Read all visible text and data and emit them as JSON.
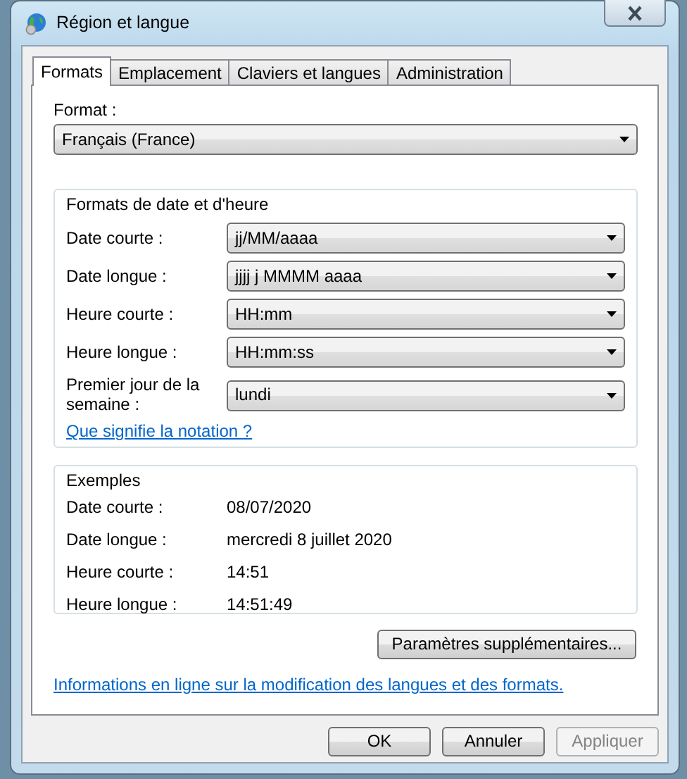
{
  "window": {
    "title": "Région et langue"
  },
  "tabs": [
    {
      "label": "Formats",
      "selected": true
    },
    {
      "label": "Emplacement",
      "selected": false
    },
    {
      "label": "Claviers et langues",
      "selected": false
    },
    {
      "label": "Administration",
      "selected": false
    }
  ],
  "format": {
    "label": "Format :",
    "value": "Français (France)"
  },
  "date_time_formats": {
    "title": "Formats de date et d'heure",
    "fields": [
      {
        "label": "Date courte :",
        "value": "jj/MM/aaaa"
      },
      {
        "label": "Date longue :",
        "value": "jjjj j MMMM aaaa"
      },
      {
        "label": "Heure courte :",
        "value": "HH:mm"
      },
      {
        "label": "Heure longue :",
        "value": "HH:mm:ss"
      },
      {
        "label": "Premier jour de la semaine :",
        "value": "lundi"
      }
    ],
    "link": "Que signifie la notation ?"
  },
  "examples": {
    "title": "Exemples",
    "rows": [
      {
        "label": "Date courte :",
        "value": "08/07/2020"
      },
      {
        "label": "Date longue :",
        "value": "mercredi 8 juillet 2020"
      },
      {
        "label": "Heure courte :",
        "value": "14:51"
      },
      {
        "label": "Heure longue :",
        "value": "14:51:49"
      }
    ]
  },
  "additional_settings_button": "Paramètres supplémentaires...",
  "online_link": "Informations en ligne sur la modification des langues et des formats.",
  "buttons": [
    {
      "label": "OK",
      "disabled": false
    },
    {
      "label": "Annuler",
      "disabled": false
    },
    {
      "label": "Appliquer",
      "disabled": true
    }
  ]
}
